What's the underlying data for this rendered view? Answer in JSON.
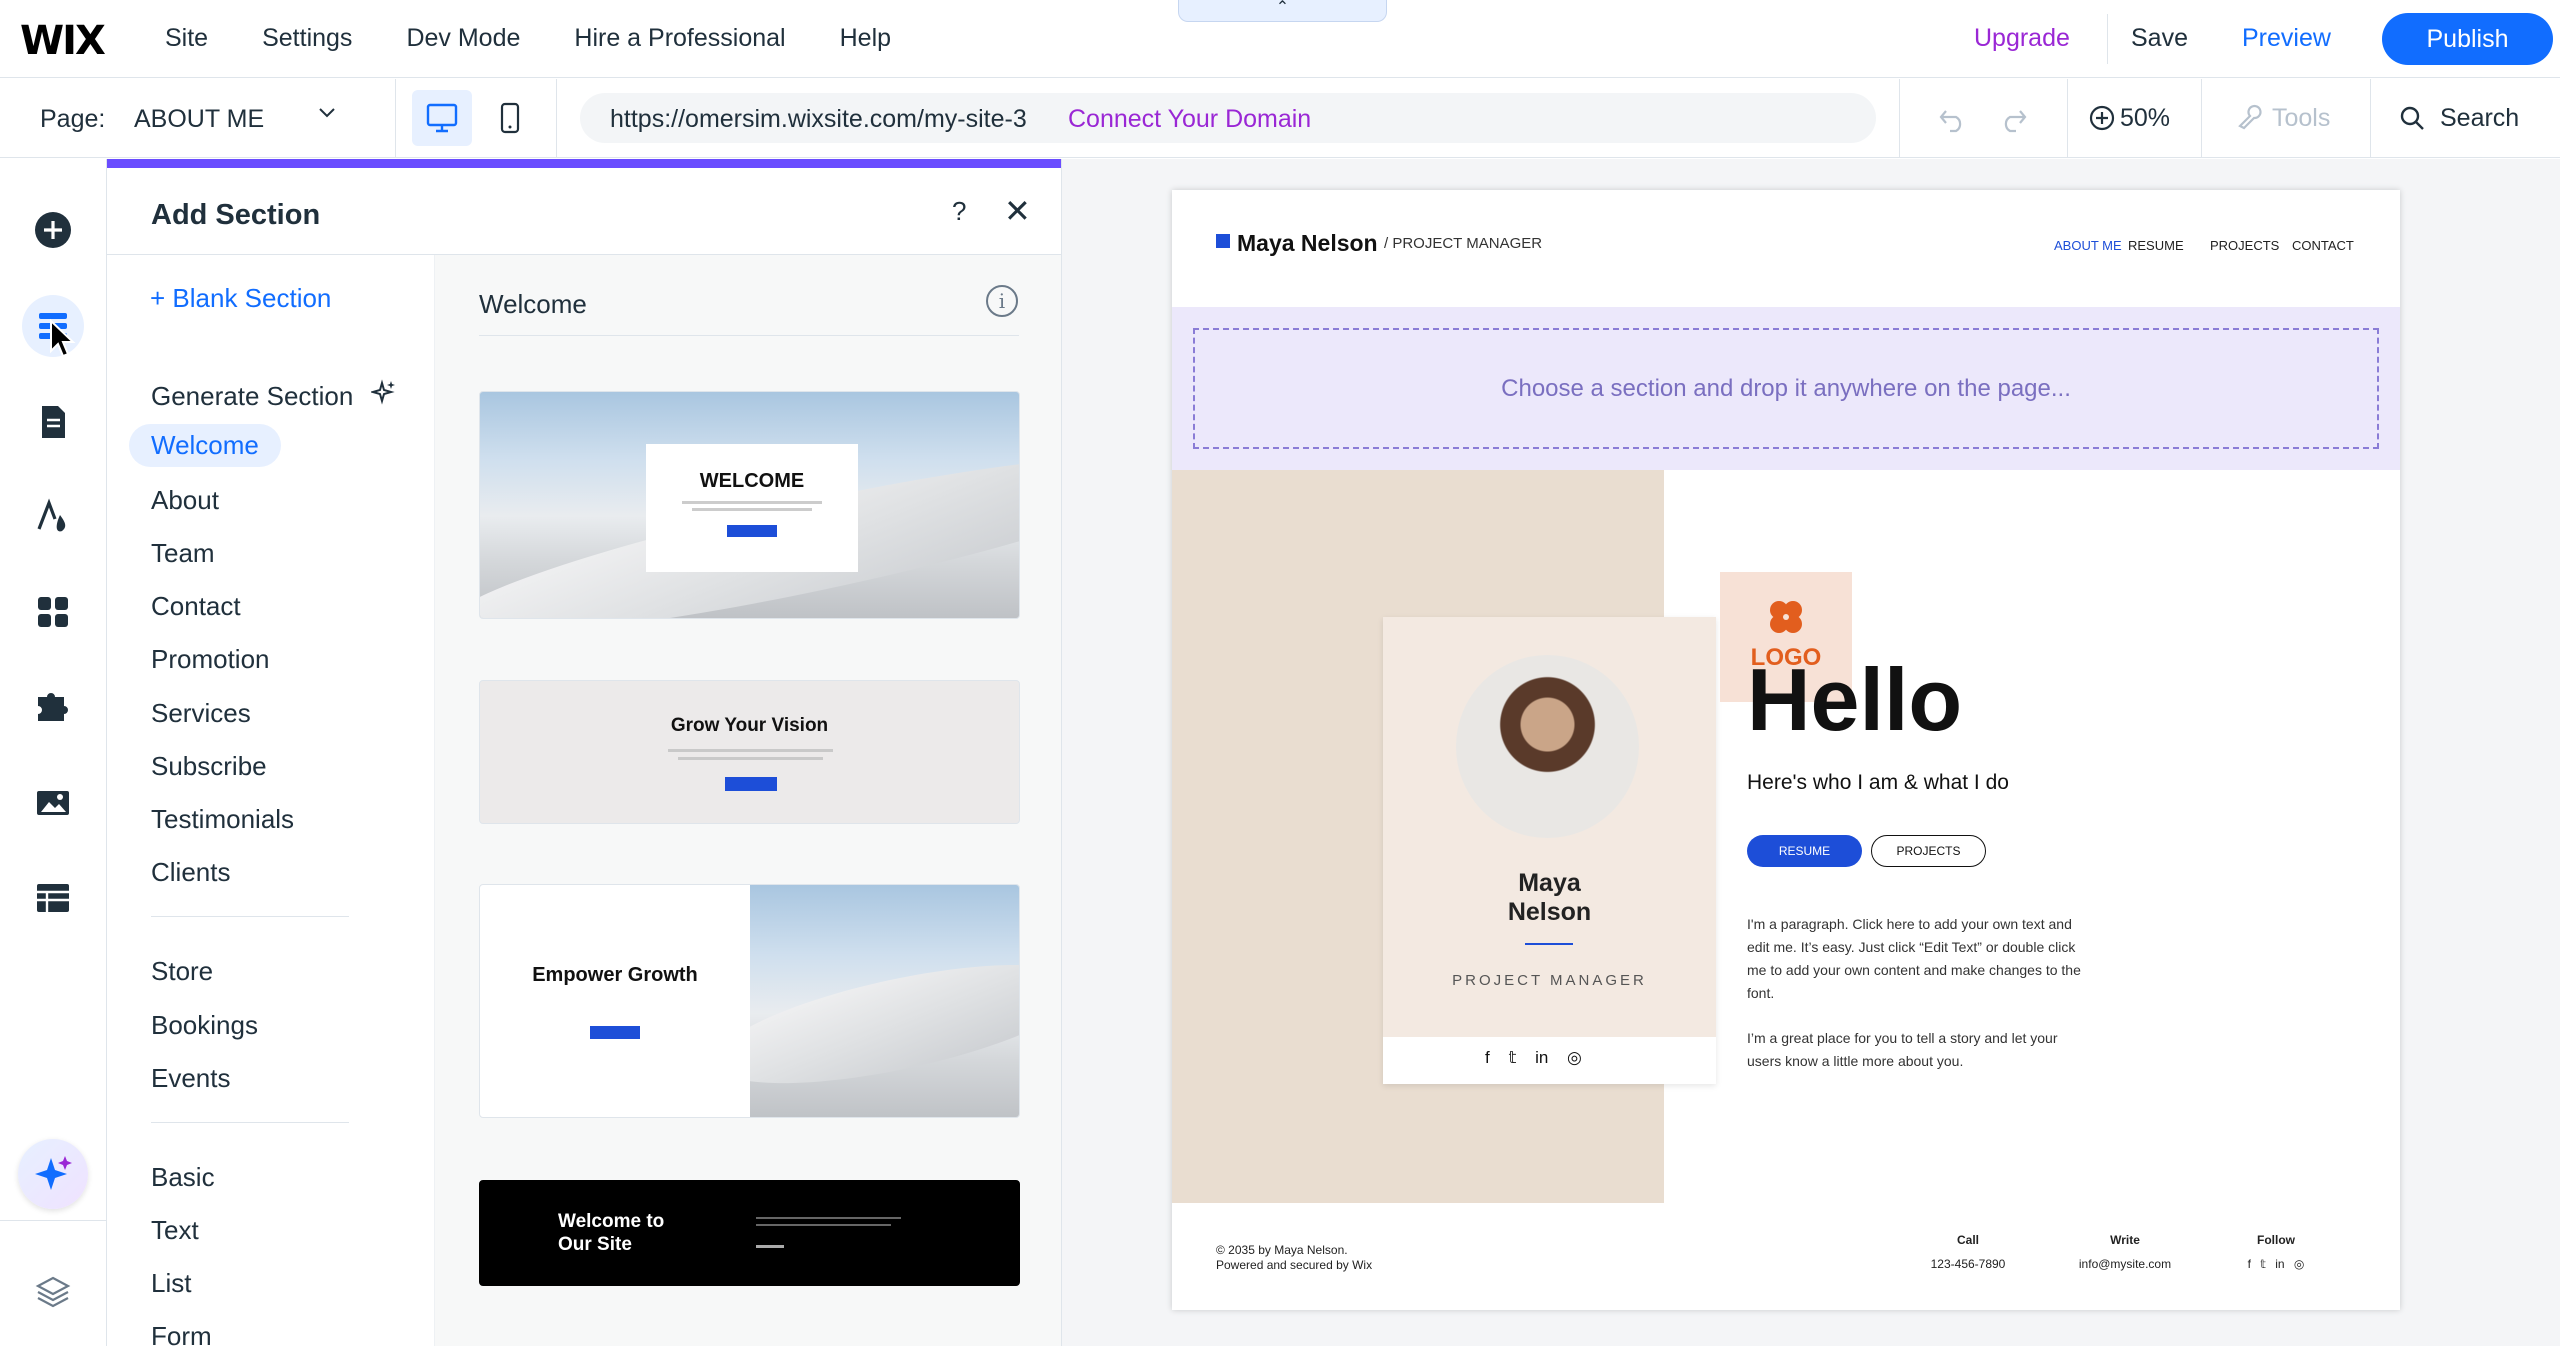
{
  "topbar": {
    "logo": "WIX",
    "menu": [
      "Site",
      "Settings",
      "Dev Mode",
      "Hire a Professional",
      "Help"
    ],
    "collapse_icon": "⌃",
    "upgrade": "Upgrade",
    "save": "Save",
    "preview": "Preview",
    "publish": "Publish"
  },
  "bar2": {
    "page_label": "Page:",
    "page_name": "ABOUT ME",
    "url": "https://omersim.wixsite.com/my-site-3",
    "connect_domain": "Connect Your Domain",
    "zoom": "50%",
    "tools": "Tools",
    "search": "Search"
  },
  "rail": {
    "icons": [
      "add-elements-icon",
      "add-section-icon",
      "pages-icon",
      "site-design-icon",
      "apps-icon",
      "business-apps-icon",
      "media-icon",
      "cms-icon",
      "ai-assistant-icon",
      "layers-icon"
    ]
  },
  "panel": {
    "title": "Add Section",
    "help": "?",
    "close": "✕",
    "blank_section": "+ Blank Section",
    "generate_section": "Generate Section",
    "categories_1": [
      "Welcome",
      "About",
      "Team",
      "Contact",
      "Promotion",
      "Services",
      "Subscribe",
      "Testimonials",
      "Clients"
    ],
    "categories_2": [
      "Store",
      "Bookings",
      "Events"
    ],
    "categories_3": [
      "Basic",
      "Text",
      "List",
      "Form"
    ],
    "selected": "Welcome",
    "templates_heading": "Welcome",
    "templates": [
      {
        "title": "WELCOME"
      },
      {
        "title": "Grow Your Vision"
      },
      {
        "title": "Empower Growth"
      },
      {
        "title": "Welcome to Our Site"
      }
    ]
  },
  "site": {
    "name": "Maya Nelson",
    "role": "/ PROJECT MANAGER",
    "nav": [
      "ABOUT ME",
      "RESUME",
      "PROJECTS",
      "CONTACT"
    ],
    "drop_text": "Choose a section and drop it anywhere on the page...",
    "card_name_1": "Maya",
    "card_name_2": "Nelson",
    "card_role": "PROJECT MANAGER",
    "card_social": "f 𝕥 in ◎",
    "logo_text": "LOGO",
    "hello": "Hello",
    "subhead": "Here's who I am & what I do",
    "btn_resume": "RESUME",
    "btn_projects": "PROJECTS",
    "para1": "I'm a paragraph. Click here to add your own text and edit me. It’s easy. Just click “Edit Text” or double click me to add your own content and make changes to the font.",
    "para2": "I’m a great place for you to tell a story and let your users know a little more about you.",
    "footer_copy_1": "© 2035 by Maya Nelson.",
    "footer_copy_2": "Powered and secured by Wix",
    "call_label": "Call",
    "call_value": "123-456-7890",
    "write_label": "Write",
    "write_value": "info@mysite.com",
    "follow_label": "Follow",
    "follow_icons": "f 𝕥 in ◎"
  },
  "colors": {
    "accent": "#116dff",
    "upgrade": "#9a27d5",
    "panel_topline": "#6a4cff",
    "site_blue": "#1d4ed8",
    "logo_orange": "#e25e1e"
  }
}
